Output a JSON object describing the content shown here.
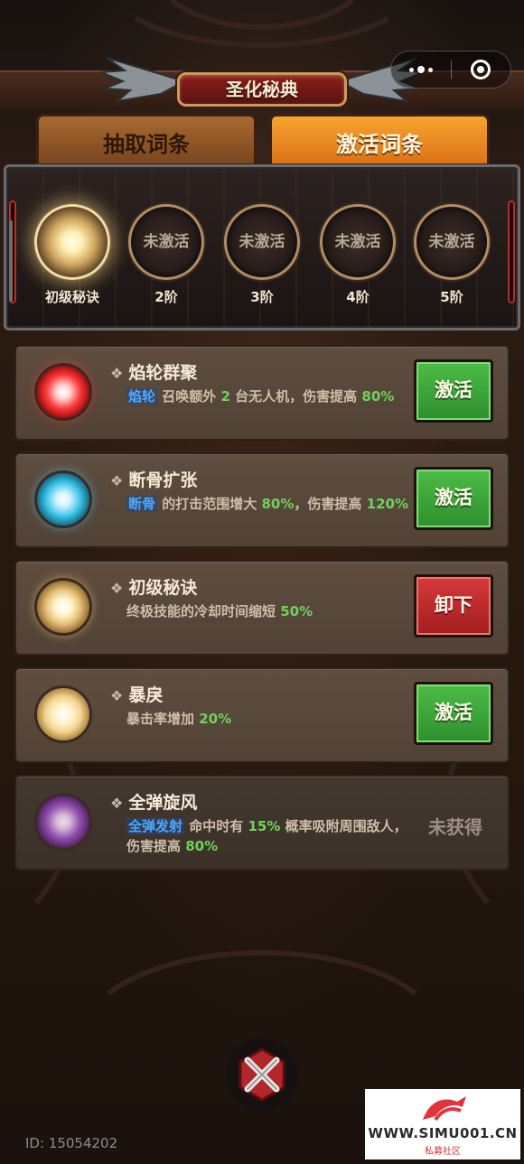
{
  "header": {
    "title": "圣化秘典",
    "menu_icon": "more-dots-icon",
    "close_icon": "target-close-icon"
  },
  "tabs": [
    {
      "label": "抽取词条",
      "active": false
    },
    {
      "label": "激活词条",
      "active": true
    }
  ],
  "stages": [
    {
      "label": "初级秘诀",
      "inner": "",
      "activated": true
    },
    {
      "label": "2阶",
      "inner": "未激活",
      "activated": false
    },
    {
      "label": "3阶",
      "inner": "未激活",
      "activated": false
    },
    {
      "label": "4阶",
      "inner": "未激活",
      "activated": false
    },
    {
      "label": "5阶",
      "inner": "未激活",
      "activated": false
    }
  ],
  "skills": [
    {
      "name": "焰轮群聚",
      "orb": "red",
      "desc_keyword": "焰轮",
      "desc_1": "召唤额外",
      "desc_num1": "2",
      "desc_2": "台无人机，伤害提高",
      "desc_num2": "80%",
      "button": "激活"
    },
    {
      "name": "断骨扩张",
      "orb": "cyan",
      "desc_keyword": "断骨",
      "desc_1": "的打击范围增大",
      "desc_num1": "80%",
      "desc_2": "，伤害提高",
      "desc_num2": "120%",
      "button": "激活"
    },
    {
      "name": "初级秘诀",
      "orb": "gold",
      "desc_1": "终极技能的冷却时间缩短",
      "desc_num1": "50%",
      "button": "卸下"
    },
    {
      "name": "暴戾",
      "orb": "gold2",
      "desc_1": "暴击率增加",
      "desc_num1": "20%",
      "button": "激活"
    },
    {
      "name": "全弹旋风",
      "orb": "purple",
      "desc_keyword": "全弹发射",
      "desc_1": "命中时有",
      "desc_num1": "15%",
      "desc_2": "概率吸附周围敌人，伤害提高",
      "desc_num2": "80%",
      "status": "未获得"
    }
  ],
  "footer": {
    "close_icon": "crossed-swords-close-icon",
    "user_id": "ID: 15054202"
  },
  "watermark": {
    "url": "WWW.SIMU001.CN",
    "subtitle": "私募社区"
  },
  "colors": {
    "active_tab": "#f39a2a",
    "activate_button": "#3fa63b",
    "unequip_button": "#c42b2d",
    "keyword": "#4aa8ff",
    "number": "#6fd35a"
  }
}
